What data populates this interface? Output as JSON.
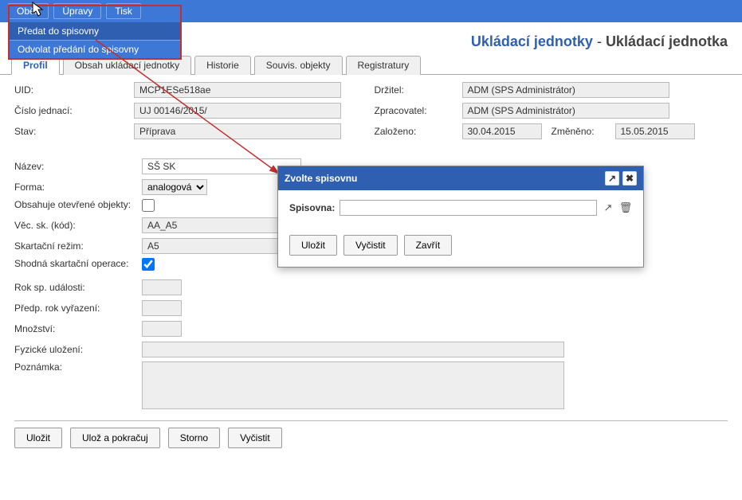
{
  "menu": {
    "items": [
      "Oběh",
      "Úpravy",
      "Tisk"
    ],
    "dropdown": [
      "Předat do spisovny",
      "Odvolat předání do spisovny"
    ]
  },
  "page": {
    "title_accent": "Ukládací jednotky",
    "title_sep": " - ",
    "title_rest": "Ukládací jednotka"
  },
  "tabs": [
    "Profil",
    "Obsah ukládací jednotky",
    "Historie",
    "Souvis. objekty",
    "Registratury"
  ],
  "left_labels": {
    "uid": "UID:",
    "cj": "Číslo jednací:",
    "stav": "Stav:",
    "nazev": "Název:",
    "forma": "Forma:",
    "obsahuje": "Obsahuje otevřené objekty:",
    "vecsk": "Věc. sk. (kód):",
    "skart": "Skartační režim:",
    "shodna": "Shodná skartační operace:",
    "roksp": "Rok sp. události:",
    "predp": "Předp. rok vyřazení:",
    "mnoz": "Množství:",
    "fyz": "Fyzické uložení:",
    "pozn": "Poznámka:"
  },
  "right_labels": {
    "drzitel": "Držitel:",
    "zprac": "Zpracovatel:",
    "zaloz": "Založeno:",
    "zmen": "Změněno:"
  },
  "values": {
    "uid": "MCP1ESe518ae",
    "cj": "UJ 00146/2015/",
    "stav": "Příprava",
    "drzitel": "ADM (SPS Administrátor)",
    "zprac": "ADM (SPS Administrátor)",
    "zaloz": "30.04.2015",
    "zmen": "15.05.2015",
    "nazev": "SŠ SK",
    "forma": "analogová",
    "vecsk": "AA_A5",
    "skart": "A5",
    "shodna_checked": true,
    "obsahuje_checked": false
  },
  "bottom_buttons": [
    "Uložit",
    "Ulož a pokračuj",
    "Storno",
    "Vyčistit"
  ],
  "dialog": {
    "title": "Zvolte spisovnu",
    "field_label": "Spisovna:",
    "value": "",
    "buttons": [
      "Uložit",
      "Vyčistit",
      "Zavřít"
    ]
  }
}
